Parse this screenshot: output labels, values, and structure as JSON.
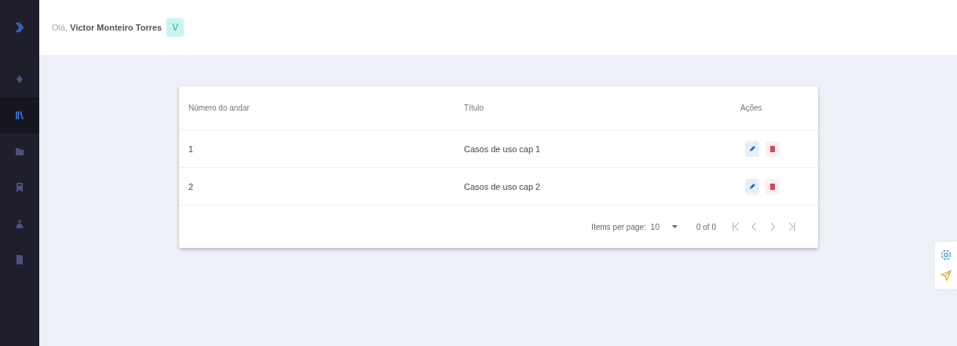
{
  "sidebar": {
    "items": [
      {
        "kind": "diamond",
        "selected": false
      },
      {
        "kind": "books",
        "selected": true
      },
      {
        "kind": "folder",
        "selected": false
      },
      {
        "kind": "bookmark",
        "selected": false
      },
      {
        "kind": "person",
        "selected": false
      },
      {
        "kind": "document",
        "selected": false
      }
    ]
  },
  "header": {
    "greeting": "Olá,",
    "user_name": "Victor Monteiro Torres",
    "avatar_letter": "V"
  },
  "table": {
    "columns": [
      "Número do andar",
      "Título",
      "Ações"
    ],
    "rows": [
      {
        "cells": [
          "1",
          "Casos de uso cap 1"
        ]
      },
      {
        "cells": [
          "2",
          "Casos de uso cap 2"
        ]
      }
    ],
    "paginator": {
      "label": "Items per page:",
      "page_size": "10",
      "range": "0 of 0"
    }
  }
}
